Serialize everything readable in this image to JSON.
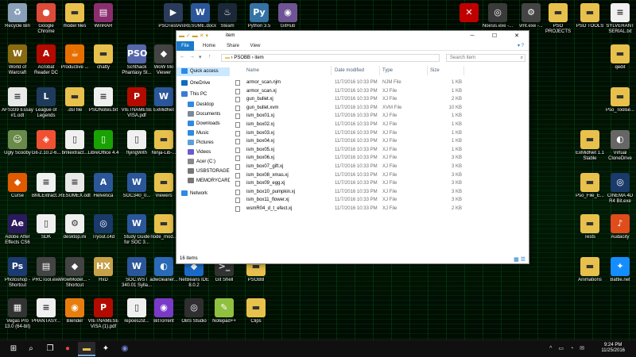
{
  "desktop_icons": [
    {
      "label": "Recycle Bin",
      "icon": "recycle-bin-icon",
      "color": "#8aa0b8",
      "glyph": "♻"
    },
    {
      "label": "Google Chrome",
      "icon": "chrome-icon",
      "color": "#dd4b39",
      "glyph": "●"
    },
    {
      "label": "model files",
      "icon": "folder-icon",
      "color": "#e8c14d",
      "glyph": "▬"
    },
    {
      "label": "WinRAR",
      "icon": "winrar-icon",
      "color": "#8b2e6f",
      "glyph": "▤"
    },
    {
      "label": "PSOTestAni...",
      "icon": "video-file-icon",
      "color": "#2b3b5a",
      "glyph": "▶"
    },
    {
      "label": "RESUME.docx",
      "icon": "word-doc-icon",
      "color": "#2b579a",
      "glyph": "W"
    },
    {
      "label": "Steam",
      "icon": "steam-icon",
      "color": "#1b2838",
      "glyph": "♨"
    },
    {
      "label": "Python 3.5",
      "icon": "python-icon",
      "color": "#3572a5",
      "glyph": "Py"
    },
    {
      "label": "GitHub",
      "icon": "github-icon",
      "color": "#6e5494",
      "glyph": "◉"
    },
    {
      "label": "",
      "icon": "x-app-icon",
      "color": "#c00000",
      "glyph": "✕"
    },
    {
      "label": "Noesis.exe -...",
      "icon": "noesis-icon",
      "color": "#3a3a3a",
      "glyph": "◎"
    },
    {
      "label": "vmt.exe -...",
      "icon": "vmt-icon",
      "color": "#444",
      "glyph": "⚙"
    },
    {
      "label": "PSO PROJECTS",
      "icon": "folder-icon",
      "color": "#e8c14d",
      "glyph": "▬"
    },
    {
      "label": "PSO TOOLS",
      "icon": "folder-icon",
      "color": "#e8c14d",
      "glyph": "▬"
    },
    {
      "label": "SYLVERANT SERIAL.txt",
      "icon": "text-file-icon",
      "color": "#f0f0f0",
      "glyph": "≡"
    },
    {
      "label": "World of Warcraft",
      "icon": "wow-icon",
      "color": "#8a6a10",
      "glyph": "W"
    },
    {
      "label": "Acrobat Reader DC",
      "icon": "acrobat-icon",
      "color": "#b30b00",
      "glyph": "A"
    },
    {
      "label": "Productive ...",
      "icon": "java-icon",
      "color": "#e76f00",
      "glyph": "☕"
    },
    {
      "label": "chatty",
      "icon": "folder-icon",
      "color": "#e8c14d",
      "glyph": "▬"
    },
    {
      "label": "Schthack Phantasy St...",
      "icon": "pso-icon",
      "color": "#5566aa",
      "glyph": "PSO"
    },
    {
      "label": "WoW Mo Viewer",
      "icon": "wow-viewer-icon",
      "color": "#444",
      "glyph": "◆"
    },
    {
      "label": "qedit",
      "icon": "folder-icon",
      "color": "#e8c14d",
      "glyph": "▬"
    },
    {
      "label": "AFS339 Essay #1.odt",
      "icon": "odt-file-icon",
      "color": "#e9e9e9",
      "glyph": "≡"
    },
    {
      "label": "League of Legends",
      "icon": "lol-icon",
      "color": "#1f3b5c",
      "glyph": "L"
    },
    {
      "label": ".dsl file",
      "icon": "folder-icon",
      "color": "#e8c14d",
      "glyph": "▬"
    },
    {
      "label": "PSONotes.txt",
      "icon": "text-file-icon",
      "color": "#f0f0f0",
      "glyph": "≡"
    },
    {
      "label": "VIETNAMESE VISA.pdf",
      "icon": "pdf-file-icon",
      "color": "#b30b00",
      "glyph": "P"
    },
    {
      "label": "ExMidNet",
      "icon": "exmidnet-icon",
      "color": "#2b579a",
      "glyph": "W"
    },
    {
      "label": "Pso_Toolse...",
      "icon": "folder-icon",
      "color": "#e8c14d",
      "glyph": "▬"
    },
    {
      "label": "Ugly Scooby",
      "icon": "image-file-icon",
      "color": "#6a8a4a",
      "glyph": "☺"
    },
    {
      "label": "Git-2.10.2-6...",
      "icon": "git-icon",
      "color": "#f05133",
      "glyph": "◈"
    },
    {
      "label": "bmlextract...",
      "icon": "file-icon",
      "color": "#f0f0f0",
      "glyph": "▯"
    },
    {
      "label": "LibreOffice 4.4",
      "icon": "libreoffice-icon",
      "color": "#18a303",
      "glyph": "▯"
    },
    {
      "label": "flyingWith",
      "icon": "file-icon",
      "color": "#f0f0f0",
      "glyph": "▯"
    },
    {
      "label": "Ninja-Lib-...",
      "icon": "folder-icon",
      "color": "#e8c14d",
      "glyph": "▬"
    },
    {
      "label": "ExMidNet 1.1 Stable",
      "icon": "folder-icon",
      "color": "#e8c14d",
      "glyph": "▬"
    },
    {
      "label": "Virtual CloneDrive",
      "icon": "clonedrive-icon",
      "color": "#666",
      "glyph": "◐"
    },
    {
      "label": "Curse",
      "icon": "curse-icon",
      "color": "#e05a00",
      "glyph": "◆"
    },
    {
      "label": "BMLExtract...",
      "icon": "text-file-icon",
      "color": "#f0f0f0",
      "glyph": "≡"
    },
    {
      "label": "RESUMEX.odt",
      "icon": "odt-file-icon",
      "color": "#e9e9e9",
      "glyph": "≡"
    },
    {
      "label": "Helvetica",
      "icon": "font-file-icon",
      "color": "#2b579a",
      "glyph": "A"
    },
    {
      "label": "SOC340_0...",
      "icon": "word-doc-icon",
      "color": "#2b579a",
      "glyph": "W"
    },
    {
      "label": "Viewers",
      "icon": "folder-icon",
      "color": "#e8c14d",
      "glyph": "▬"
    },
    {
      "label": "Pso_File_E...",
      "icon": "folder-icon",
      "color": "#e8c14d",
      "glyph": "▬"
    },
    {
      "label": "CINEMA 4D R4 Bit.exe",
      "icon": "cinema4d-icon",
      "color": "#1a3a6a",
      "glyph": "◎"
    },
    {
      "label": "Adobe After Effects CS6",
      "icon": "after-effects-icon",
      "color": "#2b1a5c",
      "glyph": "Ae"
    },
    {
      "label": "SDK",
      "icon": "file-icon",
      "color": "#f0f0f0",
      "glyph": "▯"
    },
    {
      "label": "desktop.ini",
      "icon": "ini-file-icon",
      "color": "#f0f0f0",
      "glyph": "⚙"
    },
    {
      "label": "Tryout.c4d",
      "icon": "c4d-file-icon",
      "color": "#1a3a6a",
      "glyph": "◎"
    },
    {
      "label": "Study Guide for SOC 3...",
      "icon": "word-doc-icon",
      "color": "#2b579a",
      "glyph": "W"
    },
    {
      "label": "node_mod...",
      "icon": "folder-icon",
      "color": "#e8c14d",
      "glyph": "▬"
    },
    {
      "label": "Tests",
      "icon": "folder-icon",
      "color": "#e8c14d",
      "glyph": "▬"
    },
    {
      "label": "Audacity",
      "icon": "audacity-icon",
      "color": "#e04c1a",
      "glyph": "♪"
    },
    {
      "label": "Photoshop - Shortcut",
      "icon": "photoshop-icon",
      "color": "#1b3a6f",
      "glyph": "Ps"
    },
    {
      "label": "PRCTool.exe",
      "icon": "exe-file-icon",
      "color": "#444",
      "glyph": "▤"
    },
    {
      "label": "WowModel... - Shortcut",
      "icon": "wow-model-icon",
      "color": "#444",
      "glyph": "◆"
    },
    {
      "label": "HxD",
      "icon": "hxd-icon",
      "color": "#c8a24a",
      "glyph": "HX"
    },
    {
      "label": "SOC.WST 340.01 Sylla...",
      "icon": "word-doc-icon",
      "color": "#2b579a",
      "glyph": "W"
    },
    {
      "label": "adwcleaner...",
      "icon": "adwcleaner-icon",
      "color": "#2a6ab8",
      "glyph": "◐"
    },
    {
      "label": "NetBeans IDE 8.0.2",
      "icon": "netbeans-icon",
      "color": "#1b6ac9",
      "glyph": "◆"
    },
    {
      "label": "Git Shell",
      "icon": "git-shell-icon",
      "color": "#333",
      "glyph": ">_"
    },
    {
      "label": "PSOBB",
      "icon": "folder-icon",
      "color": "#e8c14d",
      "glyph": "▬"
    },
    {
      "label": "Animations",
      "icon": "folder-icon",
      "color": "#e8c14d",
      "glyph": "▬"
    },
    {
      "label": "Battle.net",
      "icon": "battlenet-icon",
      "color": "#148eff",
      "glyph": "✦"
    },
    {
      "label": "Vegas Pro 13.0 (64-bit)",
      "icon": "vegas-icon",
      "color": "#333",
      "glyph": "▦"
    },
    {
      "label": "PHANTASY...",
      "icon": "text-file-icon",
      "color": "#f0f0f0",
      "glyph": "≡"
    },
    {
      "label": "Blender",
      "icon": "blender-icon",
      "color": "#e87d0d",
      "glyph": "◉"
    },
    {
      "label": "VIETNAMESE VISA (1).pdf",
      "icon": "pdf-file-icon",
      "color": "#b30b00",
      "glyph": "P"
    },
    {
      "label": "repoes2st...",
      "icon": "file-icon",
      "color": "#f0f0f0",
      "glyph": "▯"
    },
    {
      "label": "BitTorrent",
      "icon": "bittorrent-icon",
      "color": "#7a3ac8",
      "glyph": "◉"
    },
    {
      "label": "OBS Studio",
      "icon": "obs-icon",
      "color": "#302e31",
      "glyph": "◎"
    },
    {
      "label": "Notepad++",
      "icon": "notepadpp-icon",
      "color": "#90c040",
      "glyph": "✎"
    },
    {
      "label": "Clips",
      "icon": "folder-icon",
      "color": "#e8c14d",
      "glyph": "▬"
    }
  ],
  "explorer": {
    "title": "item",
    "ribbon_tabs": [
      "File",
      "Home",
      "Share",
      "View"
    ],
    "breadcrumb": [
      "PSOBB",
      "item"
    ],
    "search_placeholder": "Search item",
    "nav_items": [
      {
        "label": "Quick access",
        "icon": "star-icon",
        "color": "#2e8ae6",
        "selected": true
      },
      {
        "label": "OneDrive",
        "icon": "onedrive-icon",
        "color": "#0f6cbd",
        "selected": false
      },
      {
        "label": "This PC",
        "icon": "computer-icon",
        "color": "#3a7bd5",
        "selected": false
      },
      {
        "label": "Desktop",
        "icon": "desktop-icon",
        "color": "#2f8ae0",
        "selected": false
      },
      {
        "label": "Documents",
        "icon": "documents-icon",
        "color": "#7a8a9a",
        "selected": false
      },
      {
        "label": "Downloads",
        "icon": "downloads-icon",
        "color": "#2f8ae0",
        "selected": false
      },
      {
        "label": "Music",
        "icon": "music-icon",
        "color": "#2f8ae0",
        "selected": false
      },
      {
        "label": "Pictures",
        "icon": "pictures-icon",
        "color": "#5aa0d8",
        "selected": false
      },
      {
        "label": "Videos",
        "icon": "videos-icon",
        "color": "#6a5acd",
        "selected": false
      },
      {
        "label": "Acer (C:)",
        "icon": "drive-icon",
        "color": "#888888",
        "selected": false
      },
      {
        "label": "USBSTORAGE (\\",
        "icon": "usb-icon",
        "color": "#777777",
        "selected": false
      },
      {
        "label": "MEMORYCARD",
        "icon": "usb-icon",
        "color": "#777777",
        "selected": false
      },
      {
        "label": "Network",
        "icon": "network-icon",
        "color": "#2f8ae0",
        "selected": false
      }
    ],
    "columns": [
      "Name",
      "Date modified",
      "Type",
      "Size"
    ],
    "files": [
      {
        "name": "armor_scan.njm",
        "date": "11/7/2016 10:33 PM",
        "type": "NJM File",
        "size": "1 KB"
      },
      {
        "name": "armor_scan.xj",
        "date": "11/7/2016 10:33 PM",
        "type": "XJ File",
        "size": "1 KB"
      },
      {
        "name": "gun_bullet.xj",
        "date": "11/7/2016 10:33 PM",
        "type": "XJ File",
        "size": "2 KB"
      },
      {
        "name": "gun_bullet.xvm",
        "date": "11/7/2016 10:33 PM",
        "type": "XVM File",
        "size": "10 KB"
      },
      {
        "name": "ism_box01.xj",
        "date": "11/7/2016 10:33 PM",
        "type": "XJ File",
        "size": "1 KB"
      },
      {
        "name": "ism_box02.xj",
        "date": "11/7/2016 10:33 PM",
        "type": "XJ File",
        "size": "1 KB"
      },
      {
        "name": "ism_box03.xj",
        "date": "11/7/2016 10:33 PM",
        "type": "XJ File",
        "size": "1 KB"
      },
      {
        "name": "ism_box04.xj",
        "date": "11/7/2016 10:33 PM",
        "type": "XJ File",
        "size": "1 KB"
      },
      {
        "name": "ism_box05.xj",
        "date": "11/7/2016 10:33 PM",
        "type": "XJ File",
        "size": "1 KB"
      },
      {
        "name": "ism_box06.xj",
        "date": "11/7/2016 10:33 PM",
        "type": "XJ File",
        "size": "3 KB"
      },
      {
        "name": "ism_box07_gift.xj",
        "date": "11/7/2016 10:33 PM",
        "type": "XJ File",
        "size": "3 KB"
      },
      {
        "name": "ism_box08_xmas.xj",
        "date": "11/7/2016 10:33 PM",
        "type": "XJ File",
        "size": "3 KB"
      },
      {
        "name": "ism_box09_egg.xj",
        "date": "11/7/2016 10:33 PM",
        "type": "XJ File",
        "size": "3 KB"
      },
      {
        "name": "ism_box10_pumpkin.xj",
        "date": "11/7/2016 10:33 PM",
        "type": "XJ File",
        "size": "3 KB"
      },
      {
        "name": "ism_box11_flower.xj",
        "date": "11/7/2016 10:33 PM",
        "type": "XJ File",
        "size": "3 KB"
      },
      {
        "name": "wsmR04_d_t_efect.xj",
        "date": "11/7/2016 10:33 PM",
        "type": "XJ File",
        "size": "2 KB"
      }
    ],
    "status": "16 items"
  },
  "taskbar": {
    "buttons": [
      {
        "name": "start-button",
        "icon": "windows-logo-icon",
        "glyph": "⊞",
        "active": false
      },
      {
        "name": "search-button",
        "icon": "search-icon",
        "glyph": "⌕",
        "active": false
      },
      {
        "name": "task-view-button",
        "icon": "task-view-icon",
        "glyph": "❐",
        "active": false
      },
      {
        "name": "chrome-taskbar-button",
        "icon": "chrome-icon",
        "glyph": "●",
        "active": false
      },
      {
        "name": "explorer-taskbar-button",
        "icon": "folder-icon",
        "glyph": "▬",
        "active": true
      },
      {
        "name": "app-taskbar-button",
        "icon": "app-icon",
        "glyph": "✦",
        "active": false
      },
      {
        "name": "discord-taskbar-button",
        "icon": "discord-icon",
        "glyph": "◉",
        "active": false
      }
    ],
    "time": "9:24 PM",
    "date": "11/25/2016"
  },
  "colors": {
    "accent": "#1979ca",
    "selection": "#cce8ff",
    "desktop_green": "#0a8a2a"
  }
}
